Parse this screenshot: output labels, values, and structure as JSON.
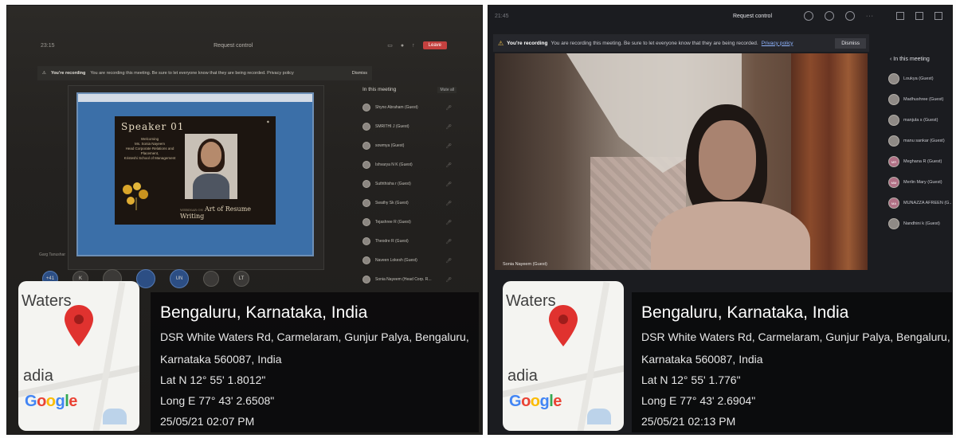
{
  "left_screen": {
    "clock": "23:15",
    "title": "Request control",
    "leave_label": "Leave",
    "banner": {
      "heading": "You're recording",
      "text": "You are recording this meeting. Be sure to let everyone know that they are being recorded. Privacy policy",
      "dismiss": "Dismiss"
    },
    "slide": {
      "title": "Speaker 01",
      "lines": [
        "Welcoming",
        "Ms. Sonia Nayeem",
        "Head Corporate Relations and",
        "Placement,",
        "Kristeshi School of Management"
      ],
      "footer": "Art of Resume Writing",
      "footer_prefix": "WEBINAR ON"
    },
    "sidebar_title": "In this meeting",
    "mute_all": "Mute all",
    "participants": [
      "Shyno Abraham (Guest)",
      "SMRITHI J (Guest)",
      "sowmya (Guest)",
      "Ishvarya N K (Guest)",
      "Suththisha r (Guest)",
      "Swathy Sk (Guest)",
      "Tejashree R (Guest)",
      "Theodre R (Guest)",
      "Naveen Lokesh (Guest)",
      "Sonia Nayeem (Head Corp. R..."
    ],
    "bottom_name": "Garg Tanushar",
    "thumbs": [
      "+41",
      "K",
      "",
      "",
      "UN",
      "",
      "LT"
    ]
  },
  "right_screen": {
    "clock": "21:45",
    "request_control": "Request control",
    "banner": {
      "heading": "You're recording",
      "text": "You are recording this meeting. Be sure to let everyone know that they are being recorded.",
      "link": "Privacy policy",
      "dismiss": "Dismiss"
    },
    "sidebar_title": "In this meeting",
    "video_name": "Sonia Nayeem (Guest)",
    "participants": [
      {
        "initials": "",
        "name": "Loukya (Guest)"
      },
      {
        "initials": "",
        "name": "Madhushree (Guest)"
      },
      {
        "initials": "",
        "name": "manjula s (Guest)"
      },
      {
        "initials": "",
        "name": "manu sankar (Guest)"
      },
      {
        "initials": "MR",
        "name": "Meghana R (Guest)"
      },
      {
        "initials": "MM",
        "name": "Merlin Mary (Guest)"
      },
      {
        "initials": "MA",
        "name": "MUNAZZA AFREEN (G..."
      },
      {
        "initials": "",
        "name": "Nandhini k (Guest)"
      }
    ]
  },
  "geotag_left": {
    "map_labels": {
      "top": "Waters",
      "bottom": "adia",
      "logo": "Google"
    },
    "place": "Bengaluru, Karnataka, India",
    "address_line1": "DSR White Waters Rd, Carmelaram, Gunjur Palya, Bengaluru,",
    "address_line2": "Karnataka 560087, India",
    "lat": "Lat N 12° 55' 1.8012\"",
    "long": "Long E 77° 43' 2.6508\"",
    "datetime": "25/05/21 02:07 PM"
  },
  "geotag_right": {
    "map_labels": {
      "top": "Waters",
      "bottom": "adia",
      "logo": "Google"
    },
    "place": "Bengaluru, Karnataka, India",
    "address_line1": "DSR White Waters Rd, Carmelaram, Gunjur Palya, Bengaluru,",
    "address_line2": "Karnataka 560087, India",
    "lat": "Lat N 12° 55' 1.776\"",
    "long": "Long E 77° 43' 2.6904\"",
    "datetime": "25/05/21 02:13 PM"
  },
  "colors": {
    "pin": "#e0322f",
    "leave_button": "#c4413f",
    "link": "#8fb4ff",
    "google_g": "#4285f4",
    "google_o1": "#ea4335",
    "google_o2": "#fbbc05",
    "google_l": "#34a853"
  }
}
